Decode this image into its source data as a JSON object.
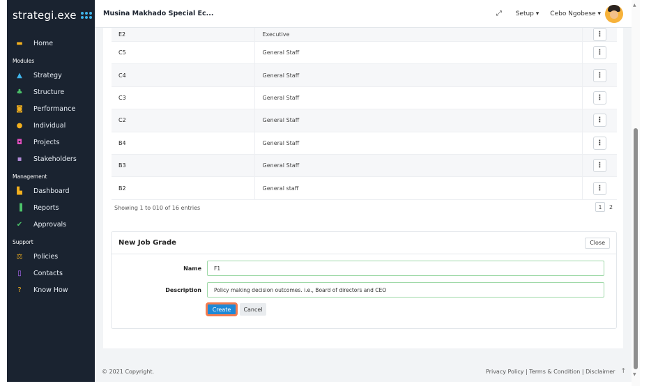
{
  "sidebar": {
    "brand": "strategi.exe",
    "items": [
      {
        "type": "item",
        "label": "Home",
        "icon": "home-icon",
        "glyph": "▬",
        "color": "#f2b01e"
      },
      {
        "type": "section",
        "label": "Modules"
      },
      {
        "type": "item",
        "label": "Strategy",
        "icon": "strategy-icon",
        "glyph": "▲",
        "color": "#3fb4ea"
      },
      {
        "type": "item",
        "label": "Structure",
        "icon": "structure-icon",
        "glyph": "♣",
        "color": "#4cc36a"
      },
      {
        "type": "item",
        "label": "Performance",
        "icon": "performance-icon",
        "glyph": "◙",
        "color": "#f2b01e"
      },
      {
        "type": "item",
        "label": "Individual",
        "icon": "individual-icon",
        "glyph": "●",
        "color": "#f2b01e"
      },
      {
        "type": "item",
        "label": "Projects",
        "icon": "projects-icon",
        "glyph": "◘",
        "color": "#e54fc0"
      },
      {
        "type": "item",
        "label": "Stakeholders",
        "icon": "stakeholders-icon",
        "glyph": "▪",
        "color": "#b38bd9"
      },
      {
        "type": "section",
        "label": "Management"
      },
      {
        "type": "item",
        "label": "Dashboard",
        "icon": "dashboard-icon",
        "glyph": "▙",
        "color": "#f2b01e"
      },
      {
        "type": "item",
        "label": "Reports",
        "icon": "reports-icon",
        "glyph": "▐",
        "color": "#4cc36a"
      },
      {
        "type": "item",
        "label": "Approvals",
        "icon": "approvals-icon",
        "glyph": "✔",
        "color": "#4cc36a"
      },
      {
        "type": "section",
        "label": "Support"
      },
      {
        "type": "item",
        "label": "Policies",
        "icon": "policies-icon",
        "glyph": "⚖",
        "color": "#f2b01e"
      },
      {
        "type": "item",
        "label": "Contacts",
        "icon": "contacts-icon",
        "glyph": "▯",
        "color": "#b36bff"
      },
      {
        "type": "item",
        "label": "Know How",
        "icon": "know-how-icon",
        "glyph": "?",
        "color": "#f2b01e"
      }
    ]
  },
  "topbar": {
    "title": "Musina Makhado Special Ec...",
    "setup_label": "Setup ▾",
    "user_label": "Cebo Ngobese ▾"
  },
  "grades_table": {
    "rows": [
      {
        "code": "E2",
        "category": "Executive"
      },
      {
        "code": "C5",
        "category": "General Staff"
      },
      {
        "code": "C4",
        "category": "General Staff"
      },
      {
        "code": "C3",
        "category": "General Staff"
      },
      {
        "code": "C2",
        "category": "General Staff"
      },
      {
        "code": "B4",
        "category": "General Staff"
      },
      {
        "code": "B3",
        "category": "General Staff"
      },
      {
        "code": "B2",
        "category": "General staff"
      }
    ],
    "action_glyph": "⋮",
    "entries_text": "Showing 1 to 010 of 16 entries",
    "pages": [
      "1",
      "2"
    ]
  },
  "new_job_grade": {
    "title": "New Job Grade",
    "close_label": "Close",
    "name_label": "Name",
    "name_value": "F1",
    "description_label": "Description",
    "description_value": "Policy making decision outcomes. i.e., Board of directors and CEO",
    "create_label": "Create",
    "cancel_label": "Cancel"
  },
  "footer": {
    "copyright": "© 2021 Copyright.",
    "links": "Privacy Policy | Terms & Condition | Disclaimer",
    "up_glyph": "↑"
  }
}
